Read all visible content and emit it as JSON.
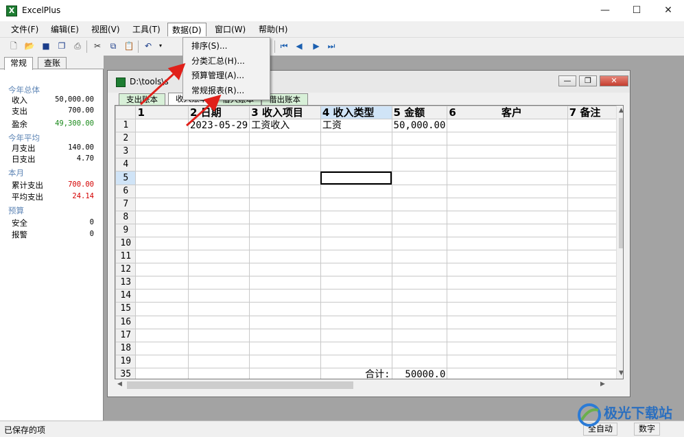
{
  "app": {
    "title": "ExcelPlus",
    "icon_letter": "X"
  },
  "window_controls": {
    "minimize": "—",
    "maximize": "☐",
    "close": "✕"
  },
  "menu": [
    "文件(F)",
    "编辑(E)",
    "视图(V)",
    "工具(T)",
    "数据(D)",
    "窗口(W)",
    "帮助(H)"
  ],
  "data_menu": [
    "排序(S)...",
    "分类汇总(H)...",
    "预算管理(A)...",
    "常规报表(R)..."
  ],
  "left_tabs": [
    "常规",
    "查账"
  ],
  "summary": {
    "year_total": {
      "head": "今年总体",
      "income_label": "收入",
      "income": "50,000.00",
      "expense_label": "支出",
      "expense": "700.00",
      "surplus_label": "盈余",
      "surplus": "49,300.00"
    },
    "year_avg": {
      "head": "今年平均",
      "monthly_label": "月支出",
      "monthly": "140.00",
      "daily_label": "日支出",
      "daily": "4.70"
    },
    "month": {
      "head": "本月",
      "total_label": "累计支出",
      "total": "700.00",
      "avg_label": "平均支出",
      "avg": "24.14"
    },
    "budget": {
      "head": "预算",
      "safe_label": "安全",
      "safe": "0",
      "alert_label": "报警",
      "alert": "0"
    }
  },
  "child_window": {
    "path": "D:\\tools\\s",
    "buttons": [
      "—",
      "❐",
      "✕"
    ]
  },
  "sheet_tabs": [
    "支出账本",
    "收入账本",
    "借入账本",
    "借出账本"
  ],
  "columns": [
    "1",
    "2 日期",
    "3 收入项目",
    "4 收入类型",
    "5 金额",
    "6",
    "客户",
    "7 备注"
  ],
  "rows": [
    {
      "num": "1",
      "cells": [
        "",
        "2023-05-29",
        "工资收入",
        "工资",
        "50,000.00",
        "",
        "",
        ""
      ]
    },
    {
      "num": "2",
      "cells": [
        "",
        "",
        "",
        "",
        "",
        "",
        "",
        ""
      ]
    },
    {
      "num": "3",
      "cells": [
        "",
        "",
        "",
        "",
        "",
        "",
        "",
        ""
      ]
    },
    {
      "num": "4",
      "cells": [
        "",
        "",
        "",
        "",
        "",
        "",
        "",
        ""
      ]
    },
    {
      "num": "5",
      "cells": [
        "",
        "",
        "",
        "",
        "",
        "",
        "",
        ""
      ]
    },
    {
      "num": "6",
      "cells": [
        "",
        "",
        "",
        "",
        "",
        "",
        "",
        ""
      ]
    },
    {
      "num": "7",
      "cells": [
        "",
        "",
        "",
        "",
        "",
        "",
        "",
        ""
      ]
    },
    {
      "num": "8",
      "cells": [
        "",
        "",
        "",
        "",
        "",
        "",
        "",
        ""
      ]
    },
    {
      "num": "9",
      "cells": [
        "",
        "",
        "",
        "",
        "",
        "",
        "",
        ""
      ]
    },
    {
      "num": "10",
      "cells": [
        "",
        "",
        "",
        "",
        "",
        "",
        "",
        ""
      ]
    },
    {
      "num": "11",
      "cells": [
        "",
        "",
        "",
        "",
        "",
        "",
        "",
        ""
      ]
    },
    {
      "num": "12",
      "cells": [
        "",
        "",
        "",
        "",
        "",
        "",
        "",
        ""
      ]
    },
    {
      "num": "13",
      "cells": [
        "",
        "",
        "",
        "",
        "",
        "",
        "",
        ""
      ]
    },
    {
      "num": "14",
      "cells": [
        "",
        "",
        "",
        "",
        "",
        "",
        "",
        ""
      ]
    },
    {
      "num": "15",
      "cells": [
        "",
        "",
        "",
        "",
        "",
        "",
        "",
        ""
      ]
    },
    {
      "num": "16",
      "cells": [
        "",
        "",
        "",
        "",
        "",
        "",
        "",
        ""
      ]
    },
    {
      "num": "17",
      "cells": [
        "",
        "",
        "",
        "",
        "",
        "",
        "",
        ""
      ]
    },
    {
      "num": "18",
      "cells": [
        "",
        "",
        "",
        "",
        "",
        "",
        "",
        ""
      ]
    },
    {
      "num": "19",
      "cells": [
        "",
        "",
        "",
        "",
        "",
        "",
        "",
        ""
      ]
    },
    {
      "num": "35",
      "cells": [
        "",
        "",
        "",
        "合计:",
        "50000.0",
        "",
        "",
        ""
      ]
    }
  ],
  "status": {
    "text": "已保存的项",
    "mode": "全自动",
    "num": "数字"
  },
  "watermark": "极光下载站",
  "colors": {
    "positive": "#1a8a1a",
    "negative": "#d40000",
    "section_head": "#5f86b6",
    "highlight": "#d0e4f7",
    "annotation_arrow": "#e0201a"
  }
}
